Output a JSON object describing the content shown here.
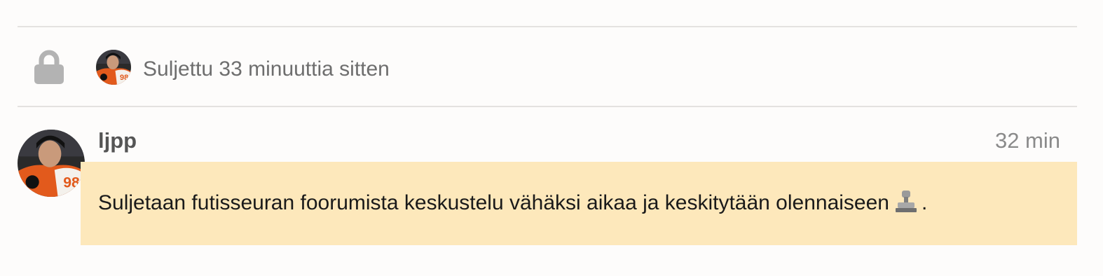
{
  "small_action": {
    "icon": "lock-icon",
    "text": "Suljettu 33 minuuttia sitten"
  },
  "post": {
    "username": "ljpp",
    "time": "32 min",
    "text_before_emoji": "Suljetaan futisseuran foorumista keskustelu vähäksi aikaa ja keskitytään olennaiseen",
    "emoji": "stamp-icon",
    "text_after_emoji": "."
  },
  "colors": {
    "background": "#fdfcfb",
    "highlight": "#fde8bb",
    "divider": "#e4e2e0",
    "muted_text": "#6e6e6e"
  }
}
